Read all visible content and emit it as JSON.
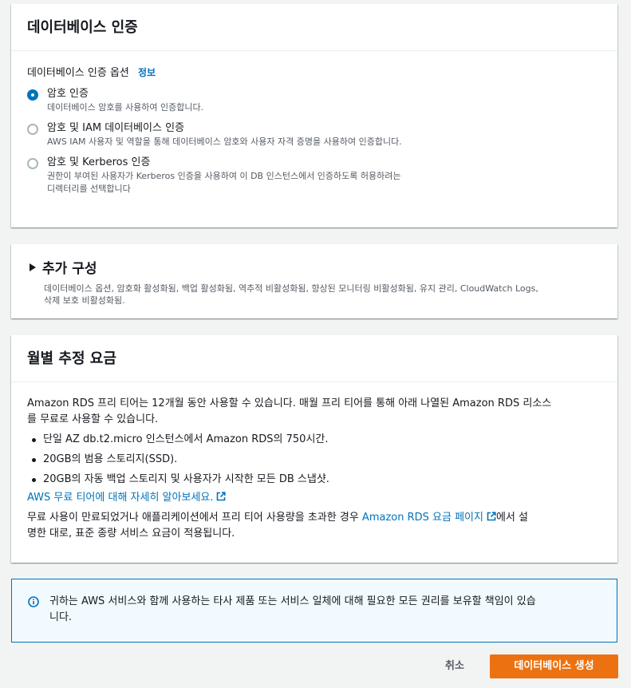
{
  "auth": {
    "title": "데이터베이스 인증",
    "field_label": "데이터베이스 인증 옵션",
    "info_link": "정보",
    "options": [
      {
        "label": "암호 인증",
        "description": "데이터베이스 암호를 사용하여 인증합니다.",
        "selected": true
      },
      {
        "label": "암호 및 IAM 데이터베이스 인증",
        "description": "AWS IAM 사용자 및 역할을 통해 데이터베이스 암호와 사용자 자격 증명을 사용하여 인증합니다.",
        "selected": false
      },
      {
        "label": "암호 및 Kerberos 인증",
        "description_line1": "권한이 부여된 사용자가 Kerberos 인증을 사용하여 이 DB 인스턴스에서 인증하도록 허용하려는",
        "description_line2": "디렉터리를 선택합니다",
        "selected": false
      }
    ]
  },
  "extra": {
    "title": "추가 구성",
    "description_line1": "데이터베이스 옵션, 암호화 활성화됨, 백업 활성화됨, 역추적 비활성화됨, 향상된 모니터링 비활성화됨, 유지 관리, CloudWatch Logs,",
    "description_line2": "삭제 보호 비활성화됨."
  },
  "pricing": {
    "title": "월별 추정 요금",
    "intro_line1": "Amazon RDS 프리 티어는 12개월 동안 사용할 수 있습니다. 매월 프리 티어를 통해 아래 나열된 Amazon RDS 리소스",
    "intro_line2": "를 무료로 사용할 수 있습니다.",
    "bullets": [
      "단일 AZ db.t2.micro 인스턴스에서 Amazon RDS의 750시간.",
      "20GB의 범용 스토리지(SSD).",
      "20GB의 자동 백업 스토리지 및 사용자가 시작한 모든 DB 스냅샷."
    ],
    "learn_more_link": "AWS 무료 티어에 대해 자세히 알아보세요.",
    "note_prefix": "무료 사용이 만료되었거나 애플리케이션에서 프리 티어 사용량을 초과한 경우 ",
    "note_link": "Amazon RDS 요금 페이지",
    "note_suffix": "에서 설",
    "note_line2": "명한 대로, 표준 종량 서비스 요금이 적용됩니다."
  },
  "alert": {
    "line1": "귀하는 AWS 서비스와 함께 사용하는 타사 제품 또는 서비스 일체에 대해 필요한 모든 권리를 보유할 책임이 있습",
    "line2": "니다."
  },
  "footer": {
    "cancel_label": "취소",
    "create_label": "데이터베이스 생성"
  },
  "colors": {
    "accent": "#0073bb",
    "primary_button": "#ec7211",
    "background": "#f2f3f3"
  }
}
